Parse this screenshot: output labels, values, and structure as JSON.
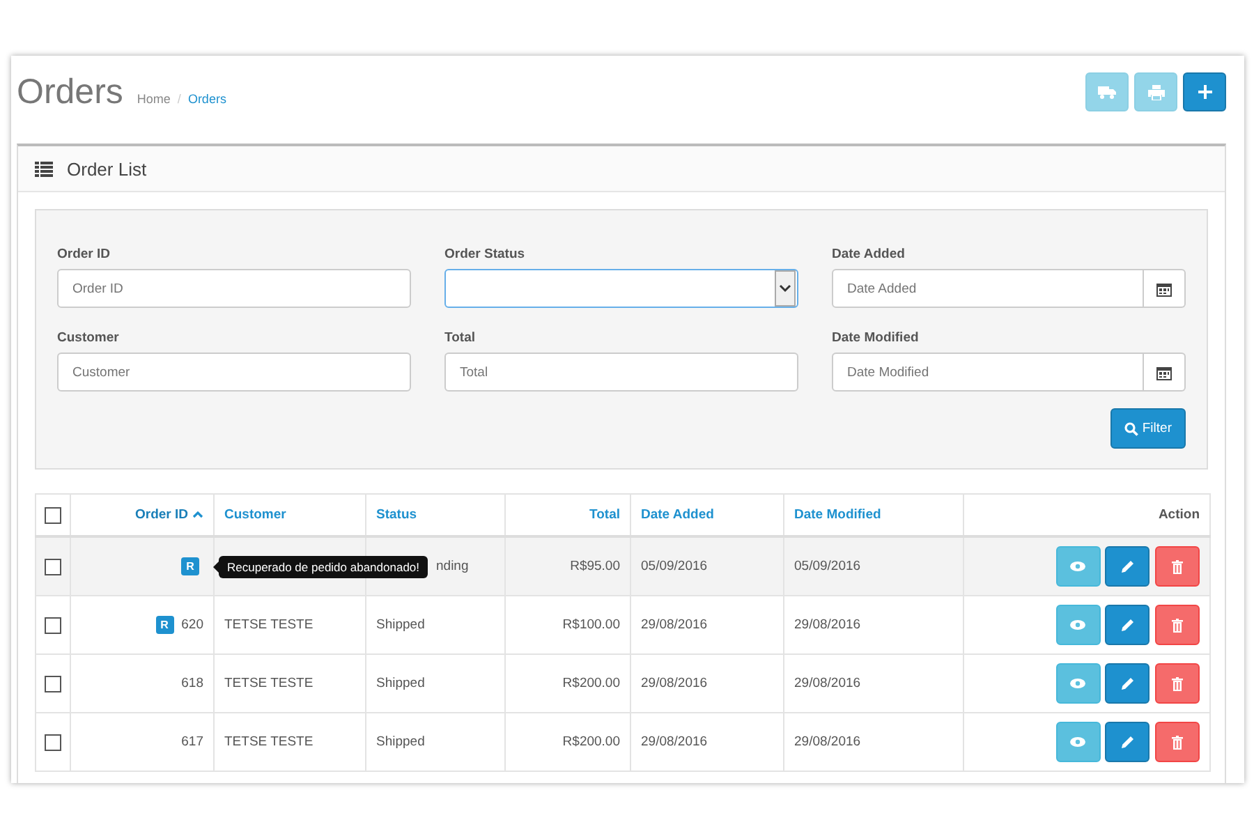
{
  "page": {
    "title": "Orders",
    "breadcrumb_separator": "/",
    "breadcrumb": [
      {
        "label": "Home",
        "current": false
      },
      {
        "label": "Orders",
        "current": true
      }
    ]
  },
  "toolbar": [
    {
      "kind": "shipping",
      "disabled": true
    },
    {
      "kind": "print",
      "disabled": true
    },
    {
      "kind": "add",
      "disabled": false
    }
  ],
  "panel": {
    "title": "Order List"
  },
  "filters": [
    {
      "label": "Order ID",
      "kind": "text",
      "placeholder": "Order ID"
    },
    {
      "label": "Order Status",
      "kind": "select",
      "focused": true
    },
    {
      "label": "Date Added",
      "kind": "date",
      "placeholder": "Date Added"
    },
    {
      "label": "Customer",
      "kind": "text",
      "placeholder": "Customer"
    },
    {
      "label": "Total",
      "kind": "text",
      "placeholder": "Total"
    },
    {
      "label": "Date Modified",
      "kind": "date",
      "placeholder": "Date Modified"
    }
  ],
  "filter_button": "Filter",
  "table": {
    "select_all": {
      "checked": false
    },
    "columns": [
      {
        "label": "Order ID",
        "kind": "number",
        "sorted": true
      },
      {
        "label": "Customer",
        "kind": "text",
        "sorted": false
      },
      {
        "label": "Status",
        "kind": "text",
        "sorted": false
      },
      {
        "label": "Total",
        "kind": "number",
        "sorted": false
      },
      {
        "label": "Date Added",
        "kind": "text",
        "sorted": false
      },
      {
        "label": "Date Modified",
        "kind": "text",
        "sorted": false
      },
      {
        "label": "Action",
        "kind": "action"
      }
    ],
    "rows": [
      {
        "checked": false,
        "hovered": true,
        "badge": "R",
        "tooltip": "Recuperado de pedido abandonado!",
        "status": "nding",
        "total": "R$95.00",
        "date_added": "05/09/2016",
        "date_modified": "05/09/2016"
      },
      {
        "checked": false,
        "hovered": false,
        "badge": "R",
        "order_id": "620",
        "customer": "TETSE TESTE",
        "status": "Shipped",
        "total": "R$100.00",
        "date_added": "29/08/2016",
        "date_modified": "29/08/2016"
      },
      {
        "checked": false,
        "hovered": false,
        "order_id": "618",
        "customer": "TETSE TESTE",
        "status": "Shipped",
        "total": "R$200.00",
        "date_added": "29/08/2016",
        "date_modified": "29/08/2016"
      },
      {
        "checked": false,
        "hovered": false,
        "order_id": "617",
        "customer": "TETSE TESTE",
        "status": "Shipped",
        "total": "R$200.00",
        "date_added": "29/08/2016",
        "date_modified": "29/08/2016"
      }
    ]
  }
}
